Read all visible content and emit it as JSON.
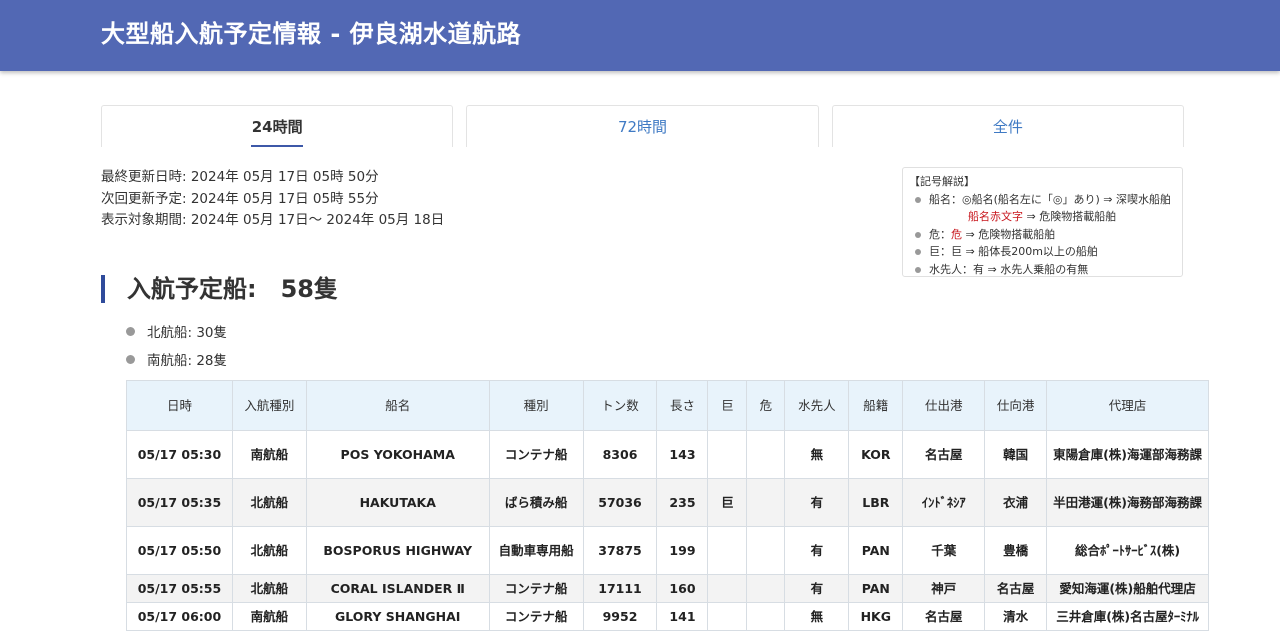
{
  "header": {
    "title": "大型船入航予定情報 - 伊良湖水道航路"
  },
  "tabs": [
    {
      "label": "24時間",
      "active": true
    },
    {
      "label": "72時間",
      "active": false
    },
    {
      "label": "全件",
      "active": false
    }
  ],
  "update_info": {
    "last_updated": "最終更新日時: 2024年 05月 17日 05時 50分",
    "next_update": "次回更新予定: 2024年 05月 17日 05時 55分",
    "display_period": "表示対象期間: 2024年 05月 17日～ 2024年 05月 18日"
  },
  "legend": {
    "title": "【記号解説】",
    "line1": "船名：◎船名(船名左に「◎」あり) ⇒ 深喫水船舶",
    "line1b_red": "船名赤文字",
    "line1b_rest": " ⇒ 危険物搭載船舶",
    "line2_prefix": "危：",
    "line2_red": "危",
    "line2_rest": " ⇒ 危険物搭載船舶",
    "line3": "巨：巨 ⇒ 船体長200m以上の船舶",
    "line4": "水先人：有 ⇒ 水先人乗船の有無"
  },
  "summary": {
    "title": "入航予定船:　58隻",
    "north": "北航船: 30隻",
    "south": "南航船: 28隻"
  },
  "table": {
    "headers": [
      "日時",
      "入航種別",
      "船名",
      "種別",
      "トン数",
      "長さ",
      "巨",
      "危",
      "水先人",
      "船籍",
      "仕出港",
      "仕向港",
      "代理店"
    ],
    "rows": [
      [
        "05/17 05:30",
        "南航船",
        "POS YOKOHAMA",
        "コンテナ船",
        "8306",
        "143",
        "",
        "",
        "無",
        "KOR",
        "名古屋",
        "韓国",
        "東陽倉庫(株)海運部海務課"
      ],
      [
        "05/17 05:35",
        "北航船",
        "HAKUTAKA",
        "ばら積み船",
        "57036",
        "235",
        "巨",
        "",
        "有",
        "LBR",
        "ｲﾝﾄﾞﾈｼｱ",
        "衣浦",
        "半田港運(株)海務部海務課"
      ],
      [
        "05/17 05:50",
        "北航船",
        "BOSPORUS HIGHWAY",
        "自動車専用船",
        "37875",
        "199",
        "",
        "",
        "有",
        "PAN",
        "千葉",
        "豊橋",
        "総合ﾎﾟｰﾄｻｰﾋﾞｽ(株)"
      ],
      [
        "05/17 05:55",
        "北航船",
        "CORAL ISLANDER Ⅱ",
        "コンテナ船",
        "17111",
        "160",
        "",
        "",
        "有",
        "PAN",
        "神戸",
        "名古屋",
        "愛知海運(株)船舶代理店"
      ],
      [
        "05/17 06:00",
        "南航船",
        "GLORY SHANGHAI",
        "コンテナ船",
        "9952",
        "141",
        "",
        "",
        "無",
        "HKG",
        "名古屋",
        "清水",
        "三井倉庫(株)名古屋ﾀｰﾐﾅﾙ"
      ]
    ]
  }
}
